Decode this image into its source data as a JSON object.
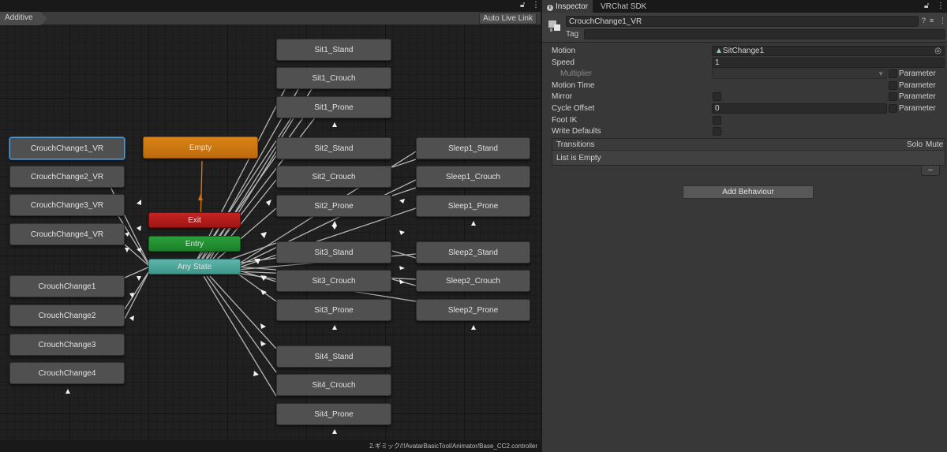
{
  "animator": {
    "layer_name": "Additive",
    "auto_live_link": "Auto Live Link",
    "lock_icon": "lock-icon",
    "menu_icon": "kebab-menu-icon",
    "controller_path": "2.ギミック/!!AvatarBasicTool/Animator/Base_CC2.controller",
    "nodes": {
      "crouchchange1_vr": "CrouchChange1_VR",
      "crouchchange2_vr": "CrouchChange2_VR",
      "crouchchange3_vr": "CrouchChange3_VR",
      "crouchchange4_vr": "CrouchChange4_VR",
      "crouchchange1": "CrouchChange1",
      "crouchchange2": "CrouchChange2",
      "crouchchange3": "CrouchChange3",
      "crouchchange4": "CrouchChange4",
      "empty": "Empty",
      "exit": "Exit",
      "entry": "Entry",
      "anystate": "Any State",
      "sit1_stand": "Sit1_Stand",
      "sit1_crouch": "Sit1_Crouch",
      "sit1_prone": "Sit1_Prone",
      "sit2_stand": "Sit2_Stand",
      "sit2_crouch": "Sit2_Crouch",
      "sit2_prone": "Sit2_Prone",
      "sit3_stand": "Sit3_Stand",
      "sit3_crouch": "Sit3_Crouch",
      "sit3_prone": "Sit3_Prone",
      "sit4_stand": "Sit4_Stand",
      "sit4_crouch": "Sit4_Crouch",
      "sit4_prone": "Sit4_Prone",
      "sleep1_stand": "Sleep1_Stand",
      "sleep1_crouch": "Sleep1_Crouch",
      "sleep1_prone": "Sleep1_Prone",
      "sleep2_stand": "Sleep2_Stand",
      "sleep2_crouch": "Sleep2_Crouch",
      "sleep2_prone": "Sleep2_Prone"
    }
  },
  "inspector": {
    "tabs": [
      "Inspector",
      "VRChat SDK"
    ],
    "state_name": "CrouchChange1_VR",
    "tag_label": "Tag",
    "tag_value": "",
    "rows": {
      "motion_label": "Motion",
      "motion_value": "SitChange1",
      "speed_label": "Speed",
      "speed_value": "1",
      "multiplier_label": "Multiplier",
      "motion_time_label": "Motion Time",
      "mirror_label": "Mirror",
      "cycle_offset_label": "Cycle Offset",
      "cycle_offset_value": "0",
      "foot_ik_label": "Foot IK",
      "write_defaults_label": "Write Defaults",
      "parameter_label": "Parameter"
    },
    "transitions": {
      "title": "Transitions",
      "solo": "Solo",
      "mute": "Mute",
      "empty_text": "List is Empty",
      "remove_label": "–"
    },
    "add_behaviour": "Add Behaviour"
  },
  "colors": {
    "selected_border": "#4f9fd6",
    "default_state": "#d98216",
    "exit_node": "#c42424",
    "entry_node": "#2aa03a",
    "any_state_node": "#5fb5aa",
    "transition_line": "#cfcfcf"
  }
}
